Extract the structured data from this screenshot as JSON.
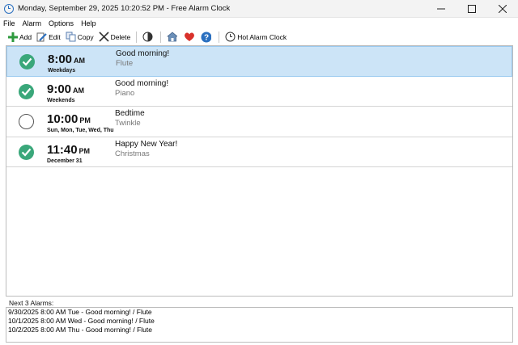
{
  "window": {
    "title": "Monday, September 29, 2025 10:20:52 PM - Free Alarm Clock",
    "app_icon": "alarm-clock-icon",
    "controls": [
      "minimize",
      "maximize",
      "close"
    ]
  },
  "menu": {
    "items": [
      {
        "label": "File"
      },
      {
        "label": "Alarm"
      },
      {
        "label": "Options"
      },
      {
        "label": "Help"
      }
    ]
  },
  "toolbar": {
    "add_label": "Add",
    "edit_label": "Edit",
    "copy_label": "Copy",
    "delete_label": "Delete",
    "hot_alarm_label": "Hot Alarm Clock",
    "icons": [
      "add-icon",
      "edit-icon",
      "copy-icon",
      "delete-icon",
      "contrast-icon",
      "home-icon",
      "heart-icon",
      "help-icon",
      "hot-alarm-clock-icon"
    ]
  },
  "alarms": [
    {
      "enabled": true,
      "time": "8:00",
      "ampm": "AM",
      "days": "Weekdays",
      "label": "Good morning!",
      "sound": "Flute",
      "selected": true
    },
    {
      "enabled": true,
      "time": "9:00",
      "ampm": "AM",
      "days": "Weekends",
      "label": "Good morning!",
      "sound": "Piano",
      "selected": false
    },
    {
      "enabled": false,
      "time": "10:00",
      "ampm": "PM",
      "days": "Sun, Mon, Tue, Wed, Thu",
      "label": "Bedtime",
      "sound": "Twinkle",
      "selected": false
    },
    {
      "enabled": true,
      "time": "11:40",
      "ampm": "PM",
      "days": "December 31",
      "label": "Happy New Year!",
      "sound": "Christmas",
      "selected": false
    }
  ],
  "next_alarms": {
    "label": "Next 3 Alarms:",
    "lines": [
      "9/30/2025 8:00 AM Tue - Good morning! / Flute",
      "10/1/2025 8:00 AM Wed - Good morning! / Flute",
      "10/2/2025 8:00 AM Thu - Good morning! / Flute"
    ]
  },
  "colors": {
    "selected_row": "#cce4f7",
    "check_on": "#3aa77a",
    "heart": "#d9312b",
    "help": "#2a6fbf",
    "add": "#2e9a3e"
  }
}
